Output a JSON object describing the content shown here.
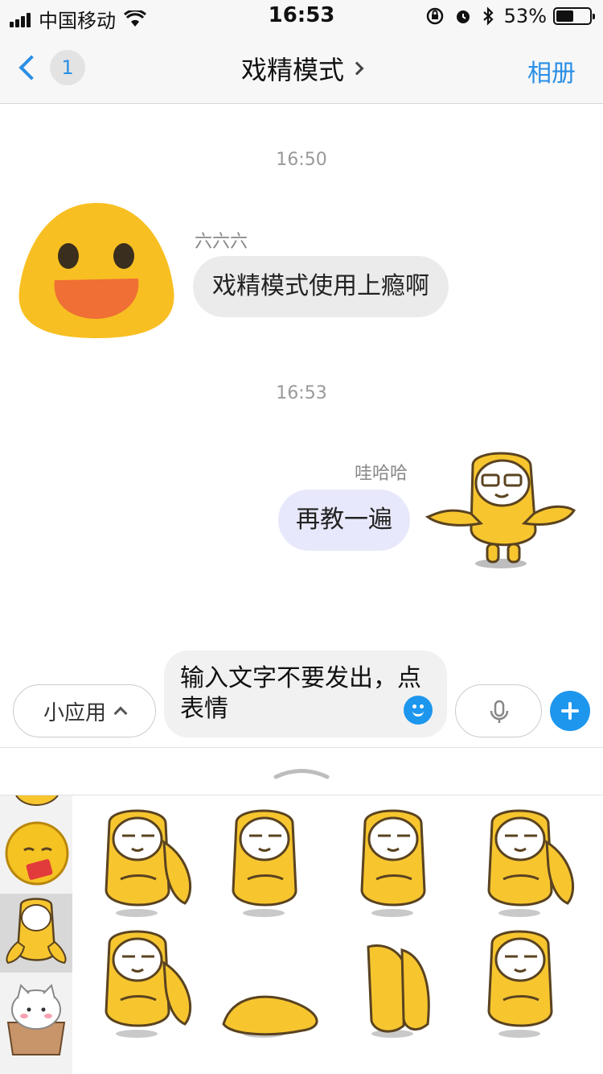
{
  "status_bar": {
    "carrier": "中国移动",
    "time": "16:53",
    "battery": "53%",
    "battery_level": 0.53
  },
  "nav": {
    "back_badge": "1",
    "title": "戏精模式",
    "right_action": "相册"
  },
  "chat": {
    "timestamps": [
      "16:50",
      "16:53"
    ],
    "messages": [
      {
        "sender": "六六六",
        "text": "戏精模式使用上瘾啊",
        "side": "left"
      },
      {
        "sender": "哇哈哈",
        "text": "再教一遍",
        "side": "right"
      }
    ]
  },
  "input_bar": {
    "apps_label": "小应用",
    "text_value": "输入文字不要发出，点表情"
  },
  "icons": {
    "back": "chevron-left-icon",
    "emoji": "smile-icon",
    "mic": "microphone-icon",
    "plus": "plus-icon",
    "expand": "chevron-up-icon"
  },
  "colors": {
    "accent": "#2a8fe6",
    "sticker_yellow": "#f7c62f",
    "bubble_right": "#e7e8fb",
    "bubble_left": "#ebebeb"
  }
}
